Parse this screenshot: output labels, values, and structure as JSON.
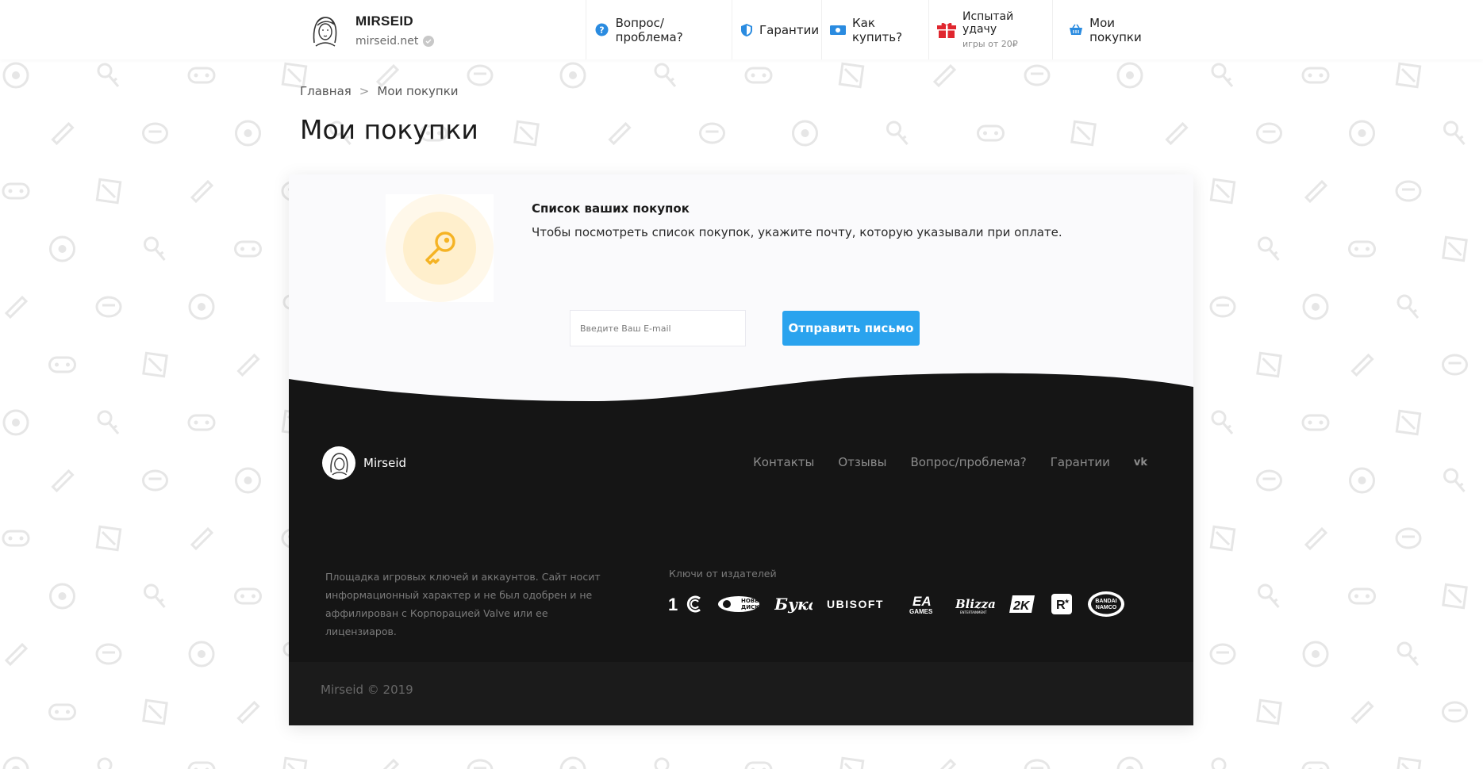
{
  "header": {
    "brand_name": "MIRSEID",
    "brand_domain": "mirseid.net",
    "nav": [
      {
        "label": "Вопрос/проблема?",
        "icon": "question-icon"
      },
      {
        "label": "Гарантии",
        "icon": "shield-icon"
      },
      {
        "label": "Как купить?",
        "icon": "money-icon"
      },
      {
        "label": "Испытай удачу",
        "sub": "игры от 20₽",
        "icon": "gift-icon"
      },
      {
        "label": "Мои покупки",
        "icon": "basket-icon"
      }
    ]
  },
  "breadcrumb": {
    "home": "Главная",
    "separator": ">",
    "current": "Мои покупки"
  },
  "page_title": "Мои покупки",
  "purchases": {
    "title": "Список ваших покупок",
    "text": "Чтобы посмотреть список покупок, укажите почту, которую указывали при оплате.",
    "email_placeholder": "Введите Ваш E-mail",
    "submit_label": "Отправить письмо"
  },
  "footer": {
    "brand_name": "Mirseid",
    "links": [
      "Контакты",
      "Отзывы",
      "Вопрос/проблема?",
      "Гарантии"
    ],
    "vk_label": "vk",
    "about": "Площадка игровых ключей и аккаунтов. Сайт носит информационный характер и не был одобрен и не аффилирован с Корпорацией Valve или ее лицензиаров.",
    "publishers_label": "Ключи от издателей",
    "publishers": [
      "1C",
      "Новый Диск",
      "Бука",
      "UBISOFT",
      "EA GAMES",
      "Blizzard",
      "2K",
      "Rockstar",
      "BANDAI NAMCO"
    ],
    "copyright": "Mirseid © 2019"
  },
  "colors": {
    "accent": "#2aa3ee",
    "footer_bg": "#151515",
    "key": "#f5b324"
  }
}
